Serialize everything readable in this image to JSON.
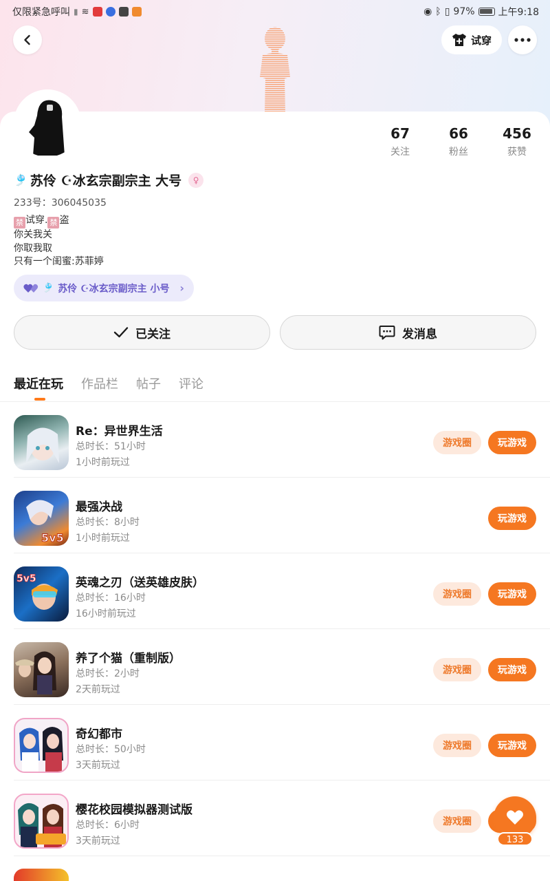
{
  "status_bar": {
    "carrier": "仅限紧急呼叫",
    "battery": "97%",
    "time": "上午9:18"
  },
  "header": {
    "tryon_label": "试穿"
  },
  "profile": {
    "stats": [
      {
        "value": "67",
        "label": "关注"
      },
      {
        "value": "66",
        "label": "粉丝"
      },
      {
        "value": "456",
        "label": "获赞"
      }
    ],
    "name": "苏伶 ☪冰玄宗副宗主 大号",
    "uid": "233号：306045035",
    "bio": {
      "line1_a": "试穿.",
      "line1_b": "盗",
      "ban_char": "禁",
      "line2": "你关我关",
      "line3": "你取我取",
      "line4": "只有一个闺蜜:苏菲婷"
    },
    "linked_account": "苏伶 ☪冰玄宗副宗主 小号"
  },
  "actions": {
    "followed": "已关注",
    "message": "发消息"
  },
  "tabs": [
    "最近在玩",
    "作品栏",
    "帖子",
    "评论"
  ],
  "games": [
    {
      "title": "Re：异世界生活",
      "duration": "总时长：51小时",
      "last_played": "1小时前玩过",
      "has_circle": true
    },
    {
      "title": "最强决战",
      "duration": "总时长：8小时",
      "last_played": "1小时前玩过",
      "has_circle": false
    },
    {
      "title": "英魂之刃（送英雄皮肤）",
      "duration": "总时长：16小时",
      "last_played": "16小时前玩过",
      "has_circle": true
    },
    {
      "title": "养了个猫（重制版）",
      "duration": "总时长：2小时",
      "last_played": "2天前玩过",
      "has_circle": true
    },
    {
      "title": "奇幻都市",
      "duration": "总时长：50小时",
      "last_played": "3天前玩过",
      "has_circle": true
    },
    {
      "title": "樱花校园模拟器测试版",
      "duration": "总时长：6小时",
      "last_played": "3天前玩过",
      "has_circle": true
    }
  ],
  "game_buttons": {
    "circle": "游戏圈",
    "play": "玩游戏"
  },
  "like_fab": {
    "count": "133"
  },
  "colors": {
    "accent": "#f57721",
    "accent_soft": "#fde9dd",
    "linked_bg": "#ecebfb"
  }
}
